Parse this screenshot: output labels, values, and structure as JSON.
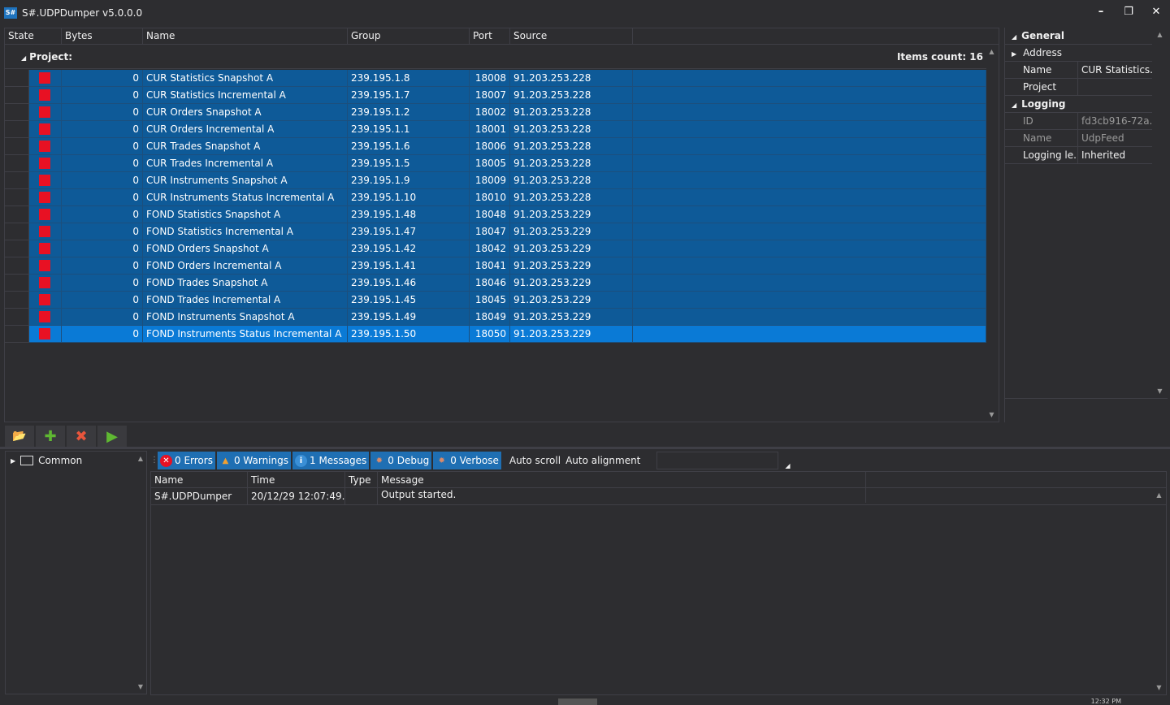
{
  "window": {
    "title": "S#.UDPDumper v5.0.0.0",
    "icon_text": "S#",
    "controls": [
      "minimize-icon",
      "restore-icon",
      "close-icon"
    ]
  },
  "grid": {
    "columns": [
      "State",
      "Bytes",
      "Name",
      "Group",
      "Port",
      "Source"
    ],
    "group_label": "Project:",
    "items_count": "Items count: 16",
    "state_color": "#e81123",
    "row_color": "#0e5a98",
    "selected_row_color": "#0a7ad6",
    "rows": [
      {
        "bytes": "0",
        "name": "CUR Statistics Snapshot A",
        "group": "239.195.1.8",
        "port": "18008",
        "source": "91.203.253.228"
      },
      {
        "bytes": "0",
        "name": "CUR Statistics Incremental A",
        "group": "239.195.1.7",
        "port": "18007",
        "source": "91.203.253.228"
      },
      {
        "bytes": "0",
        "name": "CUR Orders Snapshot A",
        "group": "239.195.1.2",
        "port": "18002",
        "source": "91.203.253.228"
      },
      {
        "bytes": "0",
        "name": "CUR Orders Incremental A",
        "group": "239.195.1.1",
        "port": "18001",
        "source": "91.203.253.228"
      },
      {
        "bytes": "0",
        "name": "CUR Trades Snapshot A",
        "group": "239.195.1.6",
        "port": "18006",
        "source": "91.203.253.228"
      },
      {
        "bytes": "0",
        "name": "CUR Trades Incremental A",
        "group": "239.195.1.5",
        "port": "18005",
        "source": "91.203.253.228"
      },
      {
        "bytes": "0",
        "name": "CUR Instruments Snapshot A",
        "group": "239.195.1.9",
        "port": "18009",
        "source": "91.203.253.228"
      },
      {
        "bytes": "0",
        "name": "CUR Instruments Status Incremental A",
        "group": "239.195.1.10",
        "port": "18010",
        "source": "91.203.253.228"
      },
      {
        "bytes": "0",
        "name": "FOND Statistics Snapshot A",
        "group": "239.195.1.48",
        "port": "18048",
        "source": "91.203.253.229"
      },
      {
        "bytes": "0",
        "name": "FOND Statistics Incremental A",
        "group": "239.195.1.47",
        "port": "18047",
        "source": "91.203.253.229"
      },
      {
        "bytes": "0",
        "name": "FOND Orders Snapshot A",
        "group": "239.195.1.42",
        "port": "18042",
        "source": "91.203.253.229"
      },
      {
        "bytes": "0",
        "name": "FOND Orders Incremental A",
        "group": "239.195.1.41",
        "port": "18041",
        "source": "91.203.253.229"
      },
      {
        "bytes": "0",
        "name": "FOND Trades Snapshot A",
        "group": "239.195.1.46",
        "port": "18046",
        "source": "91.203.253.229"
      },
      {
        "bytes": "0",
        "name": "FOND Trades Incremental A",
        "group": "239.195.1.45",
        "port": "18045",
        "source": "91.203.253.229"
      },
      {
        "bytes": "0",
        "name": "FOND Instruments Snapshot A",
        "group": "239.195.1.49",
        "port": "18049",
        "source": "91.203.253.229"
      },
      {
        "bytes": "0",
        "name": "FOND Instruments Status Incremental A",
        "group": "239.195.1.50",
        "port": "18050",
        "source": "91.203.253.229",
        "selected": true
      }
    ]
  },
  "properties": {
    "categories": [
      {
        "label": "General",
        "items": [
          {
            "key": "Address",
            "value": "",
            "expandable": true
          },
          {
            "key": "Name",
            "value": "CUR Statistics..."
          },
          {
            "key": "Project",
            "value": ""
          }
        ]
      },
      {
        "label": "Logging",
        "items": [
          {
            "key": "ID",
            "value": "fd3cb916-72a...",
            "dim": true
          },
          {
            "key": "Name",
            "value": "UdpFeed",
            "dim": true
          },
          {
            "key": "Logging le...",
            "value": "Inherited"
          }
        ]
      }
    ]
  },
  "toolbar": {
    "buttons": [
      "open-folder-icon",
      "add-icon",
      "remove-icon",
      "start-icon"
    ]
  },
  "tree": {
    "items": [
      {
        "label": "Common",
        "icon": "monitor-icon"
      }
    ]
  },
  "log": {
    "filters": [
      {
        "label": "0 Errors",
        "icon": "error-icon",
        "color": "#e81123"
      },
      {
        "label": "0 Warnings",
        "icon": "warning-icon",
        "color": "#f0a030"
      },
      {
        "label": "1 Messages",
        "icon": "info-icon",
        "color": "#3a8fd6"
      },
      {
        "label": "0 Debug",
        "icon": "debug-icon",
        "color": "#d88a6a"
      },
      {
        "label": "0 Verbose",
        "icon": "verbose-icon",
        "color": "#d88a6a"
      }
    ],
    "auto_scroll": "Auto scroll",
    "auto_alignment": "Auto alignment",
    "columns": [
      "Name",
      "Time",
      "Type",
      "Message"
    ],
    "rows": [
      {
        "name": "S#.UDPDumper",
        "time": "20/12/29 12:07:49....",
        "type": "",
        "message": "Output started."
      }
    ]
  },
  "status": {
    "clock": "12:32 PM"
  }
}
